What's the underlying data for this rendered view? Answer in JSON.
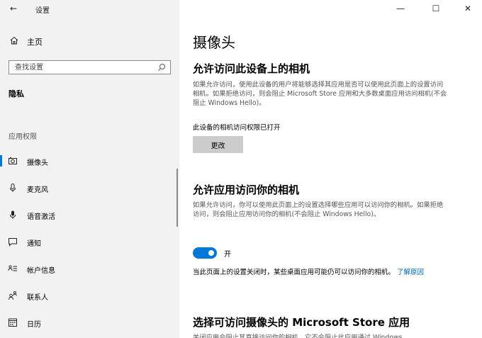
{
  "window": {
    "title": "设置",
    "back_glyph": "←",
    "minimize_glyph": "—",
    "maximize_glyph": "☐",
    "close_glyph": "✕"
  },
  "sidebar": {
    "home_label": "主页",
    "search_placeholder": "查找设置",
    "section_title": "隐私",
    "group_label": "应用权限",
    "items": [
      {
        "label": "摄像头",
        "icon": "camera-icon",
        "selected": true
      },
      {
        "label": "麦克风",
        "icon": "microphone-icon",
        "selected": false
      },
      {
        "label": "语音激活",
        "icon": "voice-activation-icon",
        "selected": false
      },
      {
        "label": "通知",
        "icon": "notification-icon",
        "selected": false
      },
      {
        "label": "帐户信息",
        "icon": "account-info-icon",
        "selected": false
      },
      {
        "label": "联系人",
        "icon": "contacts-icon",
        "selected": false
      },
      {
        "label": "日历",
        "icon": "calendar-icon",
        "selected": false
      }
    ]
  },
  "main": {
    "page_title": "摄像头",
    "section1": {
      "heading": "允许访问此设备上的相机",
      "description": "如果允许访问，使用此设备的用户将能够选择其应用是否可以使用此页面上的设置访问相机。如果拒绝访问，则会阻止 Microsoft Store 应用和大多数桌面应用访问相机(不会阻止 Windows Hello)。",
      "status": "此设备的相机访问权限已打开",
      "change_button": "更改"
    },
    "section2": {
      "heading": "允许应用访问你的相机",
      "description": "如果允许访问，你可以使用此页面上的设置选择哪些应用可以访问你的相机。如果拒绝访问，则会阻止应用访问你的相机(不会阻止 Windows Hello)。",
      "toggle_state": "on",
      "toggle_label": "开",
      "note": "当此页面上的设置关闭时，某些桌面应用可能仍可以访问你的相机。",
      "note_link": "了解原因"
    },
    "section3": {
      "heading": "选择可访问摄像头的 Microsoft Store 应用",
      "description_partial": "关闭应用会阻止其直接访问你的相机。它不会阻止此应用通过 Windows"
    }
  },
  "colors": {
    "accent": "#0078d7",
    "link": "#0067b8",
    "sidebar_bg": "#f2f2f2"
  }
}
